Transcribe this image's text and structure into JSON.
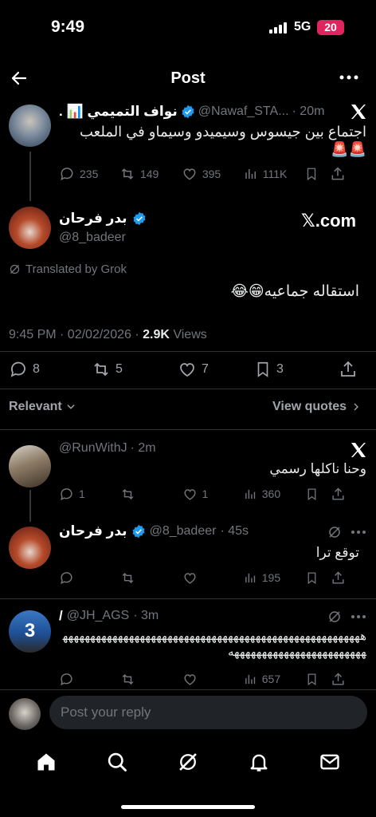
{
  "status_bar": {
    "time": "9:49",
    "network": "5G",
    "battery": "20"
  },
  "header": {
    "title": "Post"
  },
  "quoted_post": {
    "name": "نواف التميمي 📊 .",
    "handle": "@Nawaf_STA...",
    "time": "· 20m",
    "text": "اجتماع بين جيسوس وسيميدو وسيماو في الملعب 🚨🚨",
    "replies": "235",
    "reposts": "149",
    "likes": "395",
    "views": "111K"
  },
  "main_post": {
    "name": "بدر فرحان",
    "handle": "@8_badeer",
    "xcom_label": "𝕏.com",
    "translated_label": "Translated by Grok",
    "text": "استقاله جماعيه😁😂",
    "timestamp": "9:45 PM · 02/02/2026 · ",
    "views_count": "2.9K",
    "views_label": " Views",
    "replies": "8",
    "reposts": "5",
    "likes": "7",
    "bookmarks": "3"
  },
  "filters": {
    "relevant": "Relevant",
    "view_quotes": "View quotes"
  },
  "replies": [
    {
      "name": "",
      "handle": "@RunWithJ",
      "time": "· 2m",
      "text": "وحنا ناكلها رسمي",
      "replies": "1",
      "reposts": "",
      "likes": "1",
      "views": "360"
    },
    {
      "name": "بدر فرحان",
      "handle": "@8_badeer",
      "time": "· 45s",
      "text": "توقع ترا",
      "replies": "",
      "reposts": "",
      "likes": "",
      "views": "195"
    },
    {
      "name": "/",
      "handle": "@JH_AGS",
      "time": "· 3m",
      "text": "هههههههههههههههههههههههههههههههههههههههههههههههههههههههههههههههههههههههههههههههه",
      "replies": "",
      "reposts": "",
      "likes": "",
      "views": "657"
    }
  ],
  "composer": {
    "placeholder": "Post your reply"
  },
  "colors": {
    "accent": "#1d9bf0",
    "muted": "#71767b",
    "background": "#000000",
    "divider": "#2f3336",
    "battery_badge": "#e0245e"
  },
  "icons": [
    "back-arrow-icon",
    "more-icon",
    "x-logo-icon",
    "verified-icon",
    "reply-icon",
    "repost-icon",
    "like-icon",
    "views-icon",
    "bookmark-icon",
    "share-icon",
    "grok-icon",
    "home-icon",
    "search-icon",
    "notifications-icon",
    "messages-icon"
  ]
}
